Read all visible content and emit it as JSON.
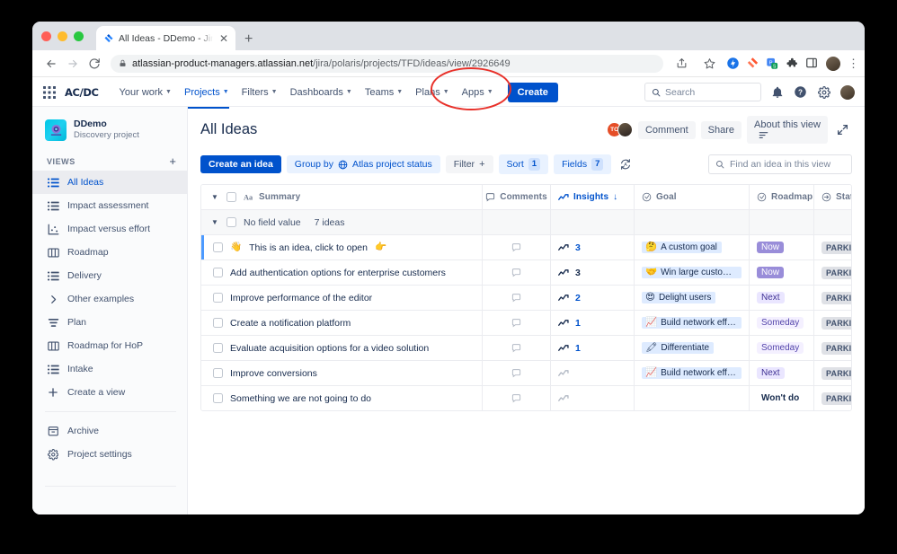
{
  "browser": {
    "tab": {
      "title": "All Ideas - DDemo - Jira Produ",
      "close_label": "✕",
      "favicon": "jira-favicon"
    },
    "new_tab_label": "+",
    "nav": {
      "back": "←",
      "forward": "→",
      "reload": "⟳"
    },
    "url": {
      "host": "atlassian-product-managers.atlassian.net",
      "path": "/jira/polaris/projects/TFD/ideas/view/2926649"
    },
    "toolbar_icons": [
      "share-icon",
      "bookmark-star-icon",
      "extension-blue-icon",
      "jira-extension-icon",
      "passwords-extension-icon",
      "puzzle-extension-icon",
      "side-panel-icon",
      "profile-avatar",
      "kebab-menu"
    ]
  },
  "topnav": {
    "app_switcher": "app-switcher-icon",
    "brand": "AC/DC",
    "items": [
      {
        "label": "Your work",
        "has_caret": true,
        "active": false
      },
      {
        "label": "Projects",
        "has_caret": true,
        "active": true
      },
      {
        "label": "Filters",
        "has_caret": true,
        "active": false
      },
      {
        "label": "Dashboards",
        "has_caret": true,
        "active": false
      },
      {
        "label": "Teams",
        "has_caret": true,
        "active": false
      },
      {
        "label": "Plans",
        "has_caret": true,
        "active": false
      },
      {
        "label": "Apps",
        "has_caret": true,
        "active": false
      }
    ],
    "create_label": "Create",
    "search_placeholder": "Search",
    "right_icons": [
      "notifications-bell-icon",
      "help-icon",
      "settings-gear-icon",
      "profile-avatar"
    ]
  },
  "annotation": {
    "target": "create-button",
    "color": "#e8312a",
    "shape": "ellipse"
  },
  "sidebar": {
    "project": {
      "name": "DDemo",
      "subtitle": "Discovery project",
      "avatar": "project-avatar"
    },
    "section_title": "VIEWS",
    "add_view_label": "+",
    "views": [
      {
        "label": "All Ideas",
        "icon": "list-view-icon",
        "selected": true
      },
      {
        "label": "Impact assessment",
        "icon": "list-view-icon",
        "selected": false
      },
      {
        "label": "Impact versus effort",
        "icon": "chart-scatter-icon",
        "selected": false
      },
      {
        "label": "Roadmap",
        "icon": "board-columns-icon",
        "selected": false
      },
      {
        "label": "Delivery",
        "icon": "list-view-icon",
        "selected": false
      },
      {
        "label": "Other examples",
        "icon": "chevron-right-icon",
        "selected": false
      },
      {
        "label": "Plan",
        "icon": "timeline-icon",
        "selected": false
      },
      {
        "label": "Roadmap for HoP",
        "icon": "board-columns-icon",
        "selected": false
      },
      {
        "label": "Intake",
        "icon": "list-view-icon",
        "selected": false
      },
      {
        "label": "Create a view",
        "icon": "plus-icon",
        "selected": false
      }
    ],
    "footer": [
      {
        "label": "Archive",
        "icon": "archive-box-icon"
      },
      {
        "label": "Project settings",
        "icon": "settings-gear-icon"
      }
    ]
  },
  "main": {
    "title": "All Ideas",
    "avatars": [
      {
        "name": "avatar-tc",
        "initials": "TC",
        "color": "#e54e27"
      },
      {
        "name": "avatar-photo",
        "initials": "",
        "color": "#4a3f34"
      }
    ],
    "actions": [
      {
        "label": "Comment",
        "name": "comment-button"
      },
      {
        "label": "Share",
        "name": "share-button"
      },
      {
        "label": "About this view",
        "name": "about-this-view-button"
      }
    ],
    "expand_label": "expand-icon",
    "toolbar": {
      "create_idea": "Create an idea",
      "group_by_label": "Group by",
      "group_by_value": "Atlas project status",
      "filter_label": "Filter",
      "filter_plus": "+",
      "sort_label": "Sort",
      "sort_count": "1",
      "fields_label": "Fields",
      "fields_count": "7",
      "refresh_icon": "auto-refresh-icon",
      "find_placeholder": "Find an idea in this view"
    },
    "table": {
      "columns": [
        {
          "key": "summary",
          "label": "Summary",
          "icon": "text-field-icon",
          "blue": false
        },
        {
          "key": "comments",
          "label": "Comments",
          "icon": "comment-icon",
          "blue": false
        },
        {
          "key": "insights",
          "label": "Insights",
          "icon": "insights-icon",
          "blue": true,
          "sort": "↓"
        },
        {
          "key": "goal",
          "label": "Goal",
          "icon": "select-field-icon",
          "blue": false
        },
        {
          "key": "roadmap",
          "label": "Roadmap",
          "icon": "select-field-icon",
          "blue": false
        },
        {
          "key": "status",
          "label": "Status",
          "icon": "status-field-icon",
          "blue": false
        }
      ],
      "group": {
        "label": "No field value",
        "count": "7 ideas"
      },
      "rows": [
        {
          "summary": "This is an idea, click to open",
          "summary_prefix_emoji": "👋",
          "summary_suffix_emoji": "👉",
          "highlighted": true,
          "comments": "",
          "insights": "3",
          "insights_active": true,
          "goal": "A custom goal",
          "goal_emoji": "🤔",
          "roadmap": "Now",
          "roadmap_style": "now",
          "status": "PARKING LOT"
        },
        {
          "summary": "Add authentication options for enterprise customers",
          "highlighted": false,
          "comments": "",
          "insights": "3",
          "insights_active": false,
          "goal": "Win large customers",
          "goal_emoji": "🤝",
          "roadmap": "Now",
          "roadmap_style": "now",
          "status": "PARKING LOT"
        },
        {
          "summary": "Improve performance of the editor",
          "highlighted": false,
          "comments": "",
          "insights": "2",
          "insights_active": true,
          "goal": "Delight users",
          "goal_emoji": "😍",
          "roadmap": "Next",
          "roadmap_style": "next",
          "status": "PARKING LOT"
        },
        {
          "summary": "Create a notification platform",
          "highlighted": false,
          "comments": "",
          "insights": "1",
          "insights_active": true,
          "goal": "Build network effects",
          "goal_emoji": "📈",
          "roadmap": "Someday",
          "roadmap_style": "someday",
          "status": "PARKING LOT"
        },
        {
          "summary": "Evaluate acquisition options for a video solution",
          "highlighted": false,
          "comments": "",
          "insights": "1",
          "insights_active": true,
          "goal": "Differentiate",
          "goal_emoji": "🖍",
          "roadmap": "Someday",
          "roadmap_style": "someday",
          "status": "PARKING LOT"
        },
        {
          "summary": "Improve conversions",
          "highlighted": false,
          "comments": "",
          "insights": "",
          "insights_active": false,
          "goal": "Build network effects",
          "goal_emoji": "📈",
          "roadmap": "Next",
          "roadmap_style": "next",
          "status": "PARKING LOT"
        },
        {
          "summary": "Something we are not going to do",
          "highlighted": false,
          "comments": "",
          "insights": "",
          "insights_active": false,
          "goal": "",
          "goal_emoji": "",
          "roadmap": "Won't do",
          "roadmap_style": "wontdo",
          "status": "PARKING LOT"
        }
      ]
    }
  },
  "colors": {
    "accent_blue": "#0052cc",
    "light_blue": "#e9f2ff",
    "annotation_red": "#e8312a",
    "sidebar_bg": "#fafbfc",
    "chip_blue": "#deebff"
  }
}
